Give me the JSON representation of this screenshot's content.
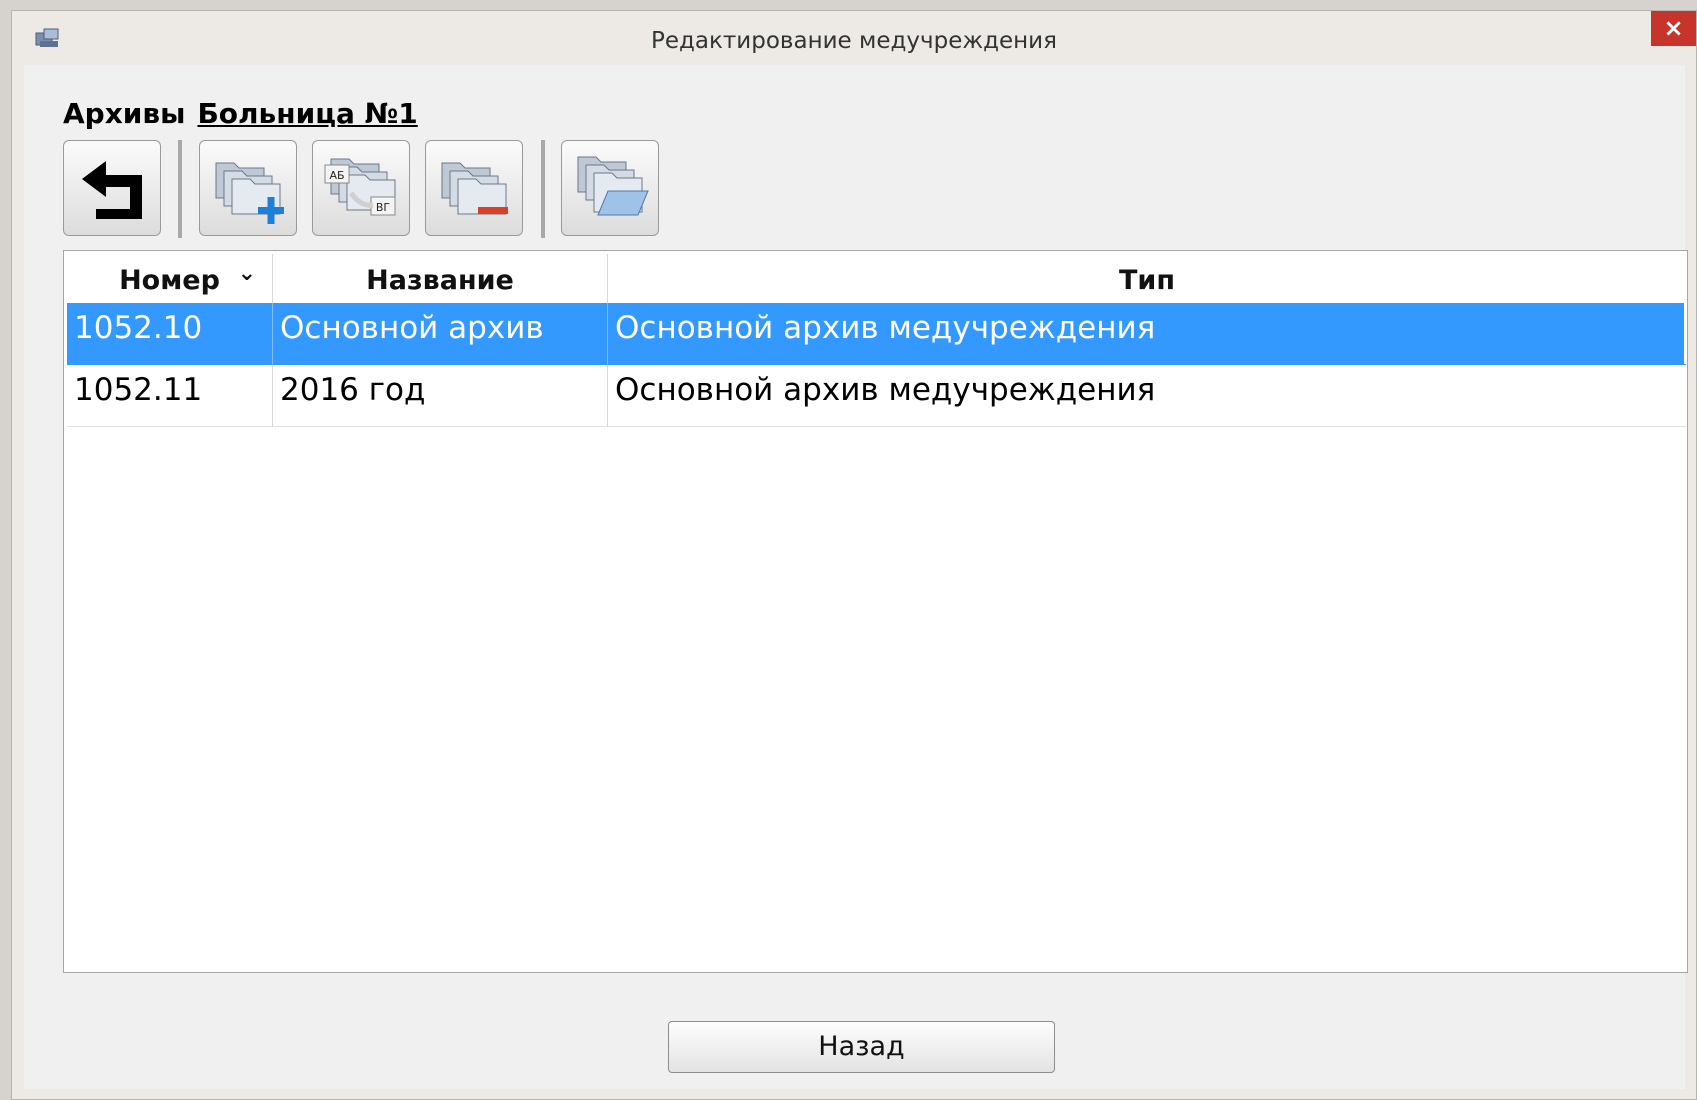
{
  "window": {
    "title": "Редактирование медучреждения",
    "close_glyph": "×",
    "app_icon": "app-icon"
  },
  "heading": {
    "label": "Архивы",
    "link": "Больница №1"
  },
  "toolbar": {
    "buttons": [
      {
        "name": "back-arrow-button",
        "icon": "return-arrow-icon"
      },
      {
        "name": "add-archive-button",
        "icon": "folder-add-icon"
      },
      {
        "name": "rename-archive-button",
        "icon": "folder-rename-icon",
        "icon_text_1": "АБ",
        "icon_text_2": "ВГ"
      },
      {
        "name": "delete-archive-button",
        "icon": "folder-remove-icon"
      },
      {
        "name": "open-archive-button",
        "icon": "folder-open-icon"
      }
    ]
  },
  "table": {
    "columns": [
      {
        "label": "Номер",
        "sort_glyph": "⌄"
      },
      {
        "label": "Название"
      },
      {
        "label": "Тип"
      }
    ],
    "rows": [
      {
        "number": "1052.10",
        "name": "Основной архив",
        "type": "Основной архив медучреждения",
        "selected": true
      },
      {
        "number": "1052.11",
        "name": "2016 год",
        "type": "Основной архив медучреждения",
        "selected": false
      }
    ]
  },
  "footer": {
    "back_label": "Назад"
  },
  "colors": {
    "selection": "#3399ff",
    "close_button": "#c7342c",
    "icon_plus": "#1e7fd8",
    "icon_minus": "#d9402a"
  }
}
